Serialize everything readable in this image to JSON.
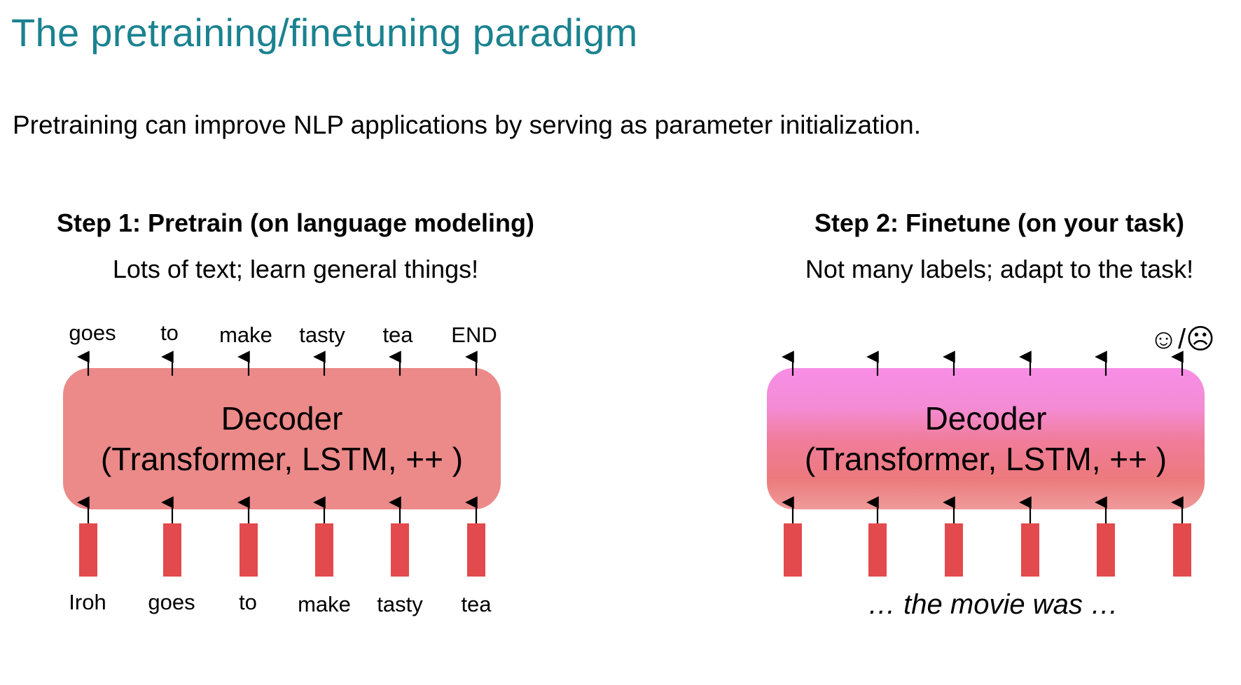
{
  "title": "The pretraining/finetuning paradigm",
  "subtitle": "Pretraining can improve NLP applications by serving as parameter initialization.",
  "step1": {
    "heading": "Step 1: Pretrain (on language modeling)",
    "subheading": "Lots of text; learn general things!",
    "decoder_line1": "Decoder",
    "decoder_line2": "(Transformer, LSTM, ++ )",
    "output_words": [
      "goes",
      "to",
      "make",
      "tasty",
      "tea",
      "END"
    ],
    "input_words": [
      "Iroh",
      "goes",
      "to",
      "make",
      "tasty",
      "tea"
    ]
  },
  "step2": {
    "heading": "Step 2: Finetune (on your task)",
    "subheading": "Not many labels; adapt to the task!",
    "decoder_line1": "Decoder",
    "decoder_line2": "(Transformer, LSTM, ++ )",
    "output_label": "☺/☹",
    "input_phrase": "… the movie was …"
  },
  "colors": {
    "title": "#1a8290",
    "decoder_left": "#ec8989",
    "decoder_right_top": "#f88ee6",
    "decoder_right_bottom": "#ec7a7c",
    "token_block": "#e34a4d"
  }
}
